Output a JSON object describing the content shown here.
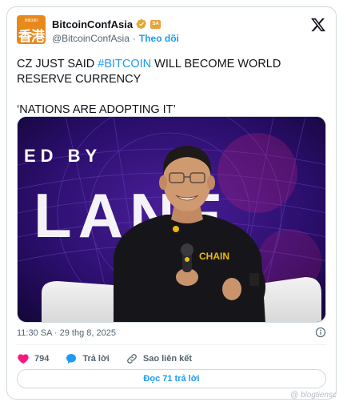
{
  "account": {
    "avatar_text_small": "Bitcoin",
    "avatar_text_big": "香港",
    "display_name": "BitcoinConfAsia",
    "affiliate_badge": "SA",
    "handle": "@BitcoinConfAsia",
    "separator": "·",
    "follow_label": "Theo dõi"
  },
  "tweet": {
    "line1_before": "CZ JUST SAID ",
    "hashtag": "#BITCOIN",
    "line1_after": " WILL BECOME WORLD RESERVE CURRENCY",
    "line2": "‘NATIONS ARE ADOPTING IT’",
    "timestamp": "11:30 SA · 29 thg 8, 2025"
  },
  "media": {
    "backdrop_text_top": "ED BY",
    "backdrop_text_big": "LANE",
    "shirt_text": "CHAIN"
  },
  "actions": {
    "like_count": "794",
    "reply_label": "Trả lời",
    "copy_link_label": "Sao liên kết"
  },
  "read_replies_label": "Đọc 71 trả lời",
  "watermark": "@ blogtiensc",
  "colors": {
    "accent": "#1d9bf0",
    "like": "#f91880",
    "brand_orange": "#e8891e"
  },
  "icons": [
    "verified-icon",
    "x-logo-icon",
    "info-icon",
    "heart-icon",
    "reply-icon",
    "link-icon"
  ]
}
